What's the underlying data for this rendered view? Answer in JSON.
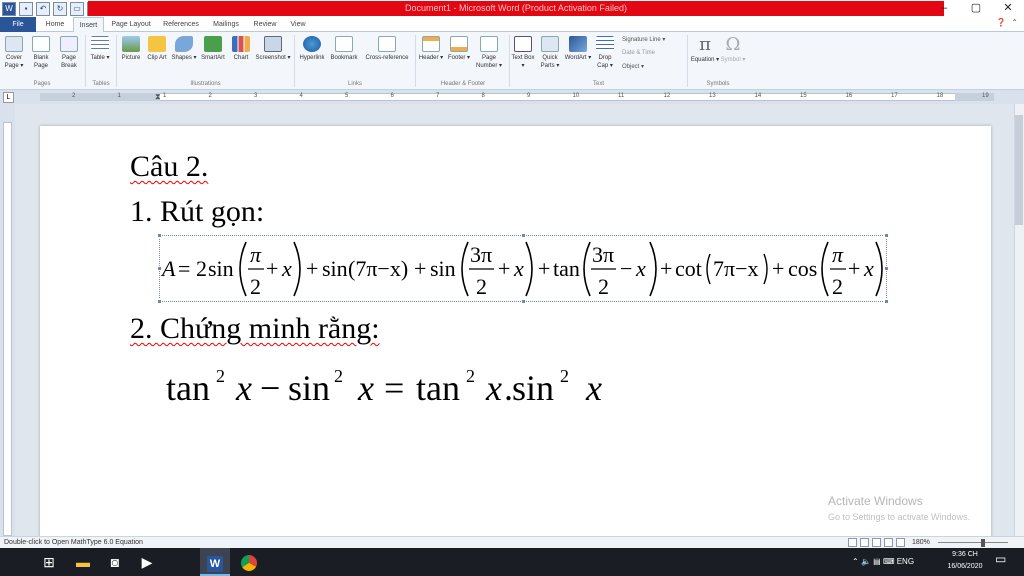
{
  "window": {
    "title": "Document1 - Microsoft Word (Product Activation Failed)",
    "controls": [
      "–",
      "▢",
      "✕"
    ]
  },
  "tabs": [
    "File",
    "Home",
    "Insert",
    "Page Layout",
    "References",
    "Mailings",
    "Review",
    "View"
  ],
  "ribbon": {
    "pages": {
      "cover": "Cover Page ▾",
      "blank": "Blank Page",
      "break": "Page Break",
      "group": "Pages"
    },
    "tables": {
      "table": "Table ▾",
      "group": "Tables"
    },
    "illustrations": {
      "picture": "Picture",
      "clipart": "Clip Art",
      "shapes": "Shapes ▾",
      "smartart": "SmartArt",
      "chart": "Chart",
      "screenshot": "Screenshot ▾",
      "group": "Illustrations"
    },
    "links": {
      "hyperlink": "Hyperlink",
      "bookmark": "Bookmark",
      "crossref": "Cross-reference",
      "group": "Links"
    },
    "headerfooter": {
      "header": "Header ▾",
      "footer": "Footer ▾",
      "pagenum": "Page Number ▾",
      "group": "Header & Footer"
    },
    "text": {
      "textbox": "Text Box ▾",
      "quickparts": "Quick Parts ▾",
      "wordart": "WordArt ▾",
      "dropcap": "Drop Cap ▾",
      "sigline": "Signature Line ▾",
      "datetime": "Date & Time",
      "object": "Object ▾",
      "group": "Text"
    },
    "symbols": {
      "equation": "Equation ▾",
      "symbol": "Symbol ▾",
      "group": "Symbols"
    }
  },
  "ruler": {
    "numbers": [
      "2",
      "1",
      "1",
      "2",
      "3",
      "4",
      "5",
      "6",
      "7",
      "8",
      "9",
      "10",
      "11",
      "12",
      "13",
      "14",
      "15",
      "16",
      "17",
      "18",
      "19",
      "20"
    ]
  },
  "document": {
    "heading": "Câu 2.",
    "item1": "1. Rút gọn:",
    "item2": "2. Chứng minh rằng:",
    "eq1": {
      "lhs": "A",
      "coef": "2",
      "pi": "π",
      "two": "2",
      "three_pi": "3π",
      "x": "x",
      "sin": "sin",
      "tan": "tan",
      "cot": "cot",
      "cos": "cos",
      "seven_pi_minus_x": "(7π−x)",
      "cot_arg": "7π−x"
    },
    "eq2": {
      "tan": "tan",
      "sin": "sin",
      "sup": "2",
      "x": "x",
      "dot": "."
    }
  },
  "watermark": {
    "line1": "Activate Windows",
    "line2": "Go to Settings to activate Windows."
  },
  "status": {
    "message": "Double-click to Open MathType 6.0 Equation",
    "zoom": "180%"
  },
  "taskbar": {
    "lang": "ENG",
    "time": "9:36 CH",
    "date": "16/06/2020"
  }
}
